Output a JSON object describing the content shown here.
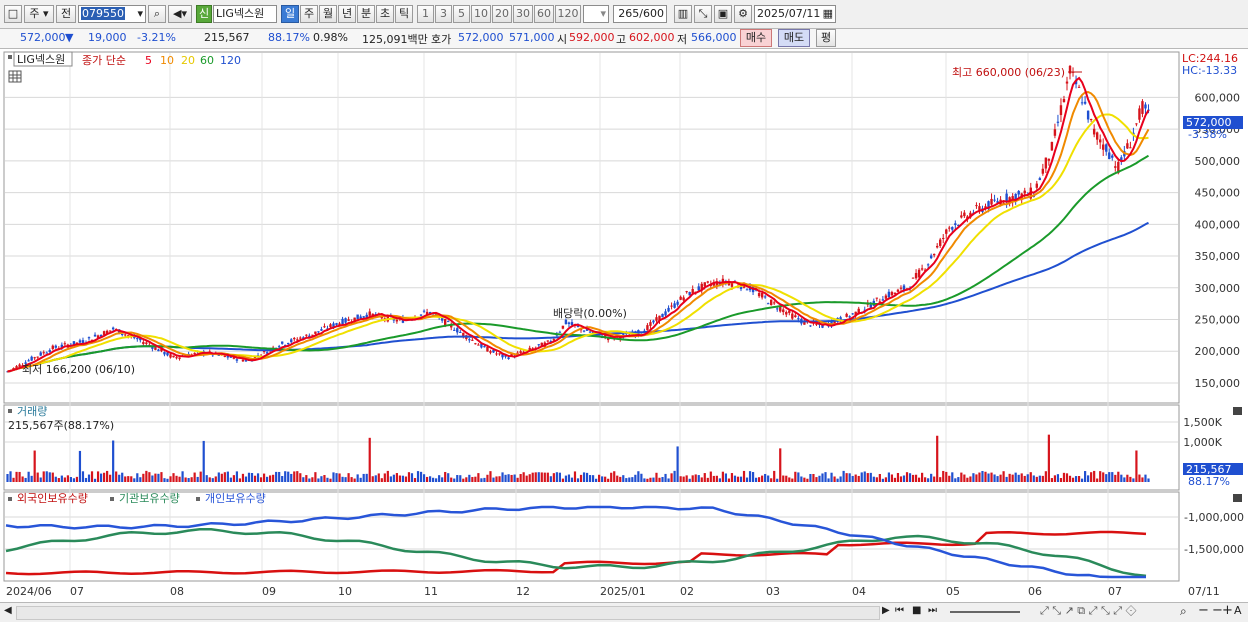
{
  "toolbar": {
    "layout_btn": "□",
    "period_type": "주",
    "jeon_label": "전",
    "code": "079550",
    "sin_badge": "신",
    "stock_name": "LIG넥스원",
    "periods": [
      "일",
      "주",
      "월",
      "년",
      "분",
      "초",
      "틱"
    ],
    "active_period": "일",
    "intervals": [
      "1",
      "3",
      "5",
      "10",
      "20",
      "30",
      "60",
      "120"
    ],
    "count": "265",
    "count_max": "/600",
    "date": "2025/07/11"
  },
  "quote": {
    "price": "572,000",
    "change": "19,000",
    "change_pct": "-3.21%",
    "volume": "215,567",
    "volume_ratio": "88.17%",
    "turnover": "0.98%",
    "amount": "125,091백만",
    "ask_label": "호가",
    "ask": "572,000",
    "bid": "571,000",
    "open_label": "시",
    "open": "592,000",
    "high_label": "고",
    "high": "602,000",
    "low_label": "저",
    "low": "566,000",
    "buy_btn": "매수",
    "sell_btn": "매도",
    "eval_btn": "평"
  },
  "price_panel": {
    "stock_tag": "LIG넥스원",
    "ma_title": "종가 단순",
    "ma_periods": [
      "5",
      "10",
      "20",
      "60",
      "120"
    ],
    "lc": "LC:244.16",
    "hc": "HC:-13.33",
    "max_annot": "최고 660,000 (06/23)",
    "min_annot": "최저 166,200 (06/10)",
    "dividend_annot": "배당락(0.00%)",
    "y_ticks": [
      "600,000",
      "550,000",
      "500,000",
      "450,000",
      "400,000",
      "350,000",
      "300,000",
      "250,000",
      "200,000",
      "150,000"
    ],
    "current_price": "572,000",
    "current_pct": "-3.38%"
  },
  "volume_panel": {
    "title": "거래량",
    "value": "215,567주(88.17%)",
    "y_ticks": [
      "1,500K",
      "1,000K"
    ],
    "current": "215,567",
    "current_pct": "88.17%"
  },
  "holding_panel": {
    "title1": "외국인보유수량",
    "title2": "기관보유수량",
    "title3": "개인보유수량",
    "y_ticks": [
      "-1,000,000",
      "-1,500,000"
    ]
  },
  "x_axis": [
    "2024/06",
    "07",
    "08",
    "09",
    "10",
    "11",
    "12",
    "2025/01",
    "02",
    "03",
    "04",
    "05",
    "06",
    "07",
    "07/11"
  ],
  "colors": {
    "ma5": "#e8001c",
    "ma10": "#f08a00",
    "ma20": "#f0e000",
    "ma60": "#1a9a2a",
    "ma120": "#2050d0",
    "up": "#d6141c",
    "down": "#1f4fd0",
    "foreign": "#d81010",
    "institution": "#2a8a5a",
    "individual": "#2855d8"
  },
  "chart_data": {
    "type": "candlestick",
    "x": [
      "2024/06",
      "07",
      "08",
      "09",
      "10",
      "11",
      "12",
      "2025/01",
      "02",
      "03",
      "04",
      "05",
      "06",
      "07"
    ],
    "close_approx": [
      168000,
      220000,
      200000,
      190000,
      240000,
      255000,
      195000,
      235000,
      225000,
      305000,
      240000,
      420000,
      500000,
      572000
    ],
    "ma120_approx": [
      145000,
      165000,
      180000,
      190000,
      205000,
      215000,
      220000,
      218000,
      225000,
      240000,
      250000,
      260000,
      300000,
      350000
    ],
    "ylim": [
      120000,
      670000
    ],
    "max": {
      "value": 660000,
      "date": "06/23"
    },
    "min": {
      "value": 166200,
      "date": "06/10"
    }
  }
}
